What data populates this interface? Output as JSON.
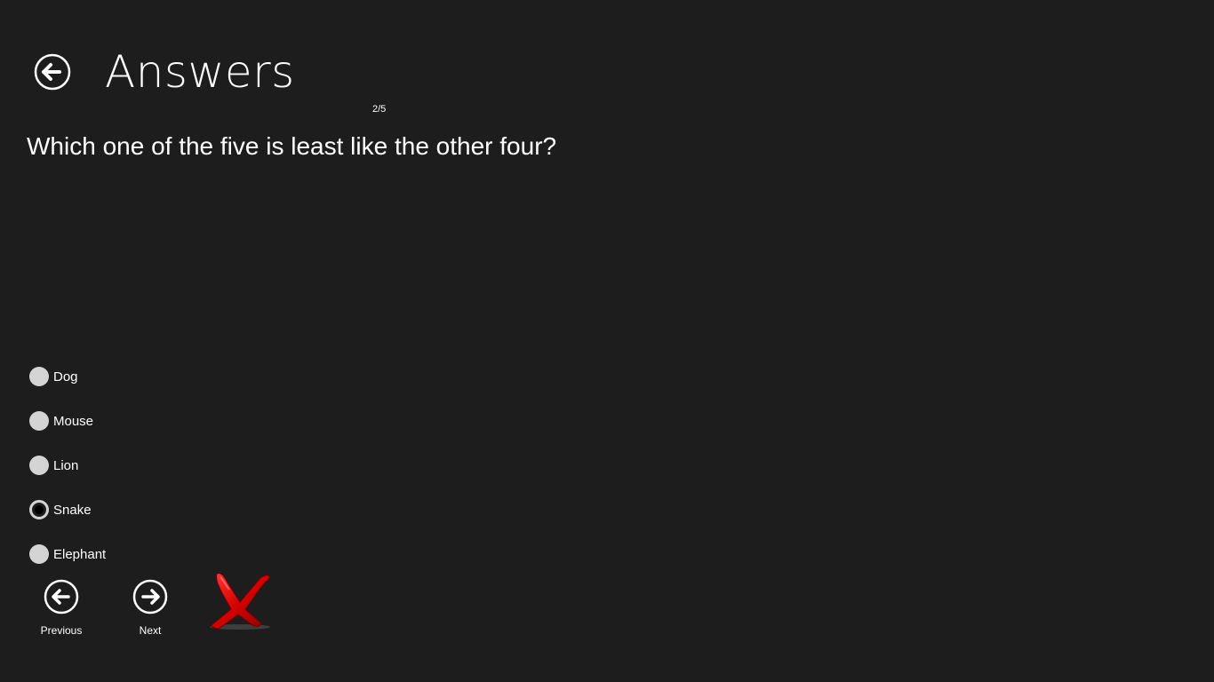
{
  "header": {
    "title": "Answers",
    "back_icon": "back-arrow-icon"
  },
  "progress": {
    "text": "2/5"
  },
  "question": {
    "text": "Which one of the five is least like the other four?"
  },
  "options": [
    {
      "label": "Dog",
      "selected": false
    },
    {
      "label": "Mouse",
      "selected": false
    },
    {
      "label": "Lion",
      "selected": false
    },
    {
      "label": "Snake",
      "selected": true
    },
    {
      "label": "Elephant",
      "selected": false
    }
  ],
  "navigation": {
    "previous_label": "Previous",
    "next_label": "Next"
  },
  "result": {
    "icon": "wrong-answer-x-icon",
    "color": "#d40000"
  },
  "colors": {
    "background": "#1d1d1d",
    "text": "#ffffff",
    "radio": "#d4d4d4"
  }
}
